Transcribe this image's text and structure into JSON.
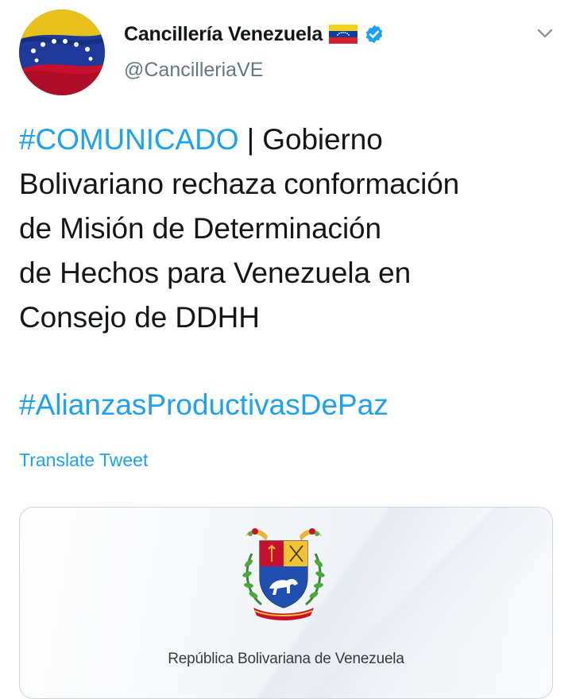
{
  "account": {
    "name": "Cancillería Venezuela",
    "handle": "@CancilleriaVE"
  },
  "icons": {
    "avatar": "venezuelan-flag-avatar",
    "flag": "venezuela-flag-emoji",
    "verified": "verified-badge-icon",
    "menu": "chevron-down-icon",
    "coat_of_arms": "coat-of-arms-icon"
  },
  "colors": {
    "link": "#1da1f2",
    "text": "#14171a",
    "muted": "#657786"
  },
  "tweet": {
    "hashtag1": "#COMUNICADO",
    "line1_rest": " | Gobierno",
    "line2": "Bolivariano rechaza conformación",
    "line3": "de Misión de Determinación",
    "line4": "de Hechos para Venezuela en",
    "line5": "Consejo de DDHH",
    "hashtag2": "#AlianzasProductivasDePaz"
  },
  "translate_label": "Translate Tweet",
  "card": {
    "caption": "República Bolivariana de Venezuela"
  }
}
